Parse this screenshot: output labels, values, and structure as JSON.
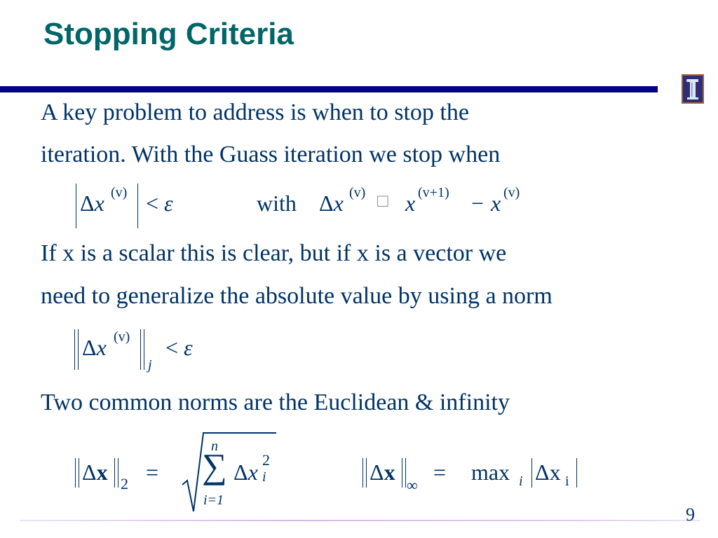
{
  "slide": {
    "title": "Stopping Criteria",
    "page_number": "9",
    "logo": "university-of-illinois-logo",
    "paragraphs": [
      "A key problem to address is when to stop the",
      "iteration.  With the Guass iteration we stop when",
      "If x is a scalar this is clear, but if x is a vector we",
      "need to generalize the absolute value by using a norm",
      "Two common norms are the Euclidean & infinity"
    ],
    "eq1": {
      "delta": "Δ",
      "x": "x",
      "sup_v": "(v)",
      "lt": "<",
      "eps": "ε",
      "with": "with",
      "box": "□",
      "sup_v1": "(v+1)",
      "minus": "−"
    },
    "eq2": {
      "delta": "Δ",
      "x": "x",
      "sup_v": "(v)",
      "sub_j": "j",
      "lt": "<",
      "eps": "ε"
    },
    "eq3": {
      "delta": "Δ",
      "xbold": "x",
      "sub_2": "2",
      "eq": "=",
      "sigma": "∑",
      "upper": "n",
      "lower": "i=1",
      "x": "x",
      "sup_2": "2",
      "sub_i": "i"
    },
    "eq4": {
      "delta": "Δ",
      "xbold": "x",
      "sub_inf": "∞",
      "eq": "=",
      "max": "max",
      "sub_i": "i",
      "xi": "x",
      "sub_i2": "i"
    }
  }
}
